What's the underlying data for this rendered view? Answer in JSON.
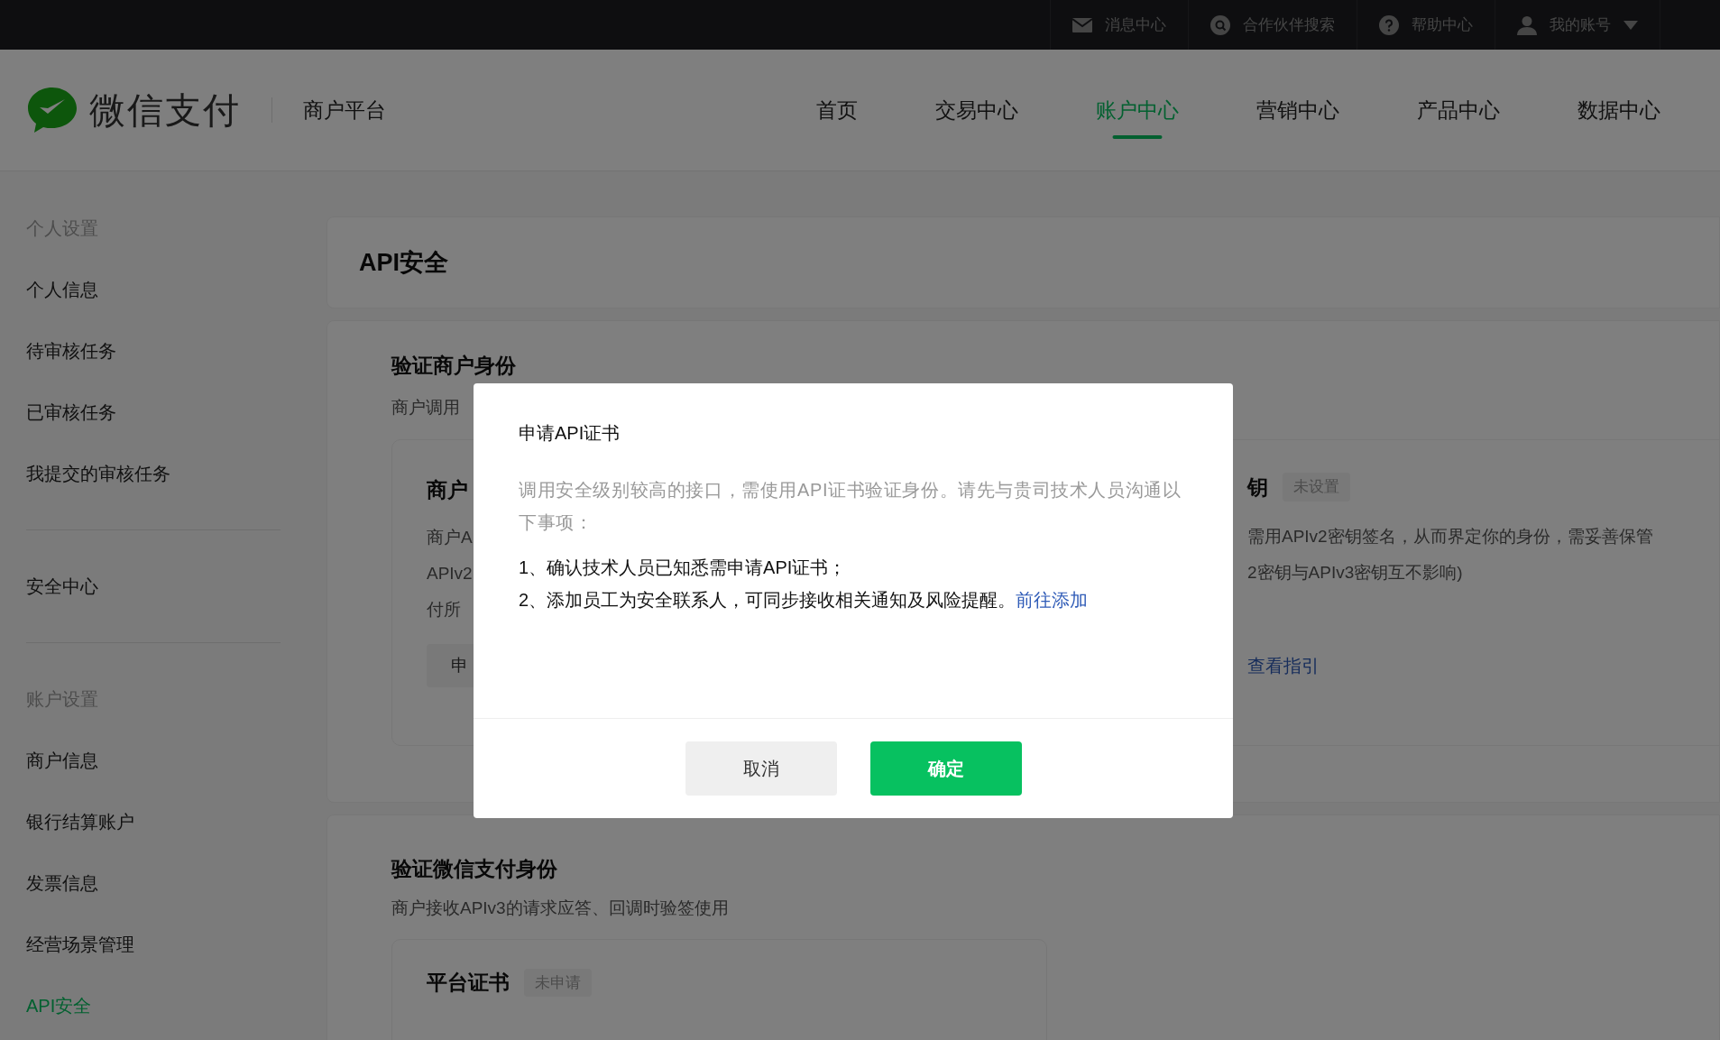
{
  "top_bar": {
    "items": [
      {
        "kind": "messages",
        "label": "消息中心"
      },
      {
        "kind": "search",
        "label": "合作伙伴搜索"
      },
      {
        "kind": "help",
        "label": "帮助中心"
      },
      {
        "kind": "account",
        "label": "我的账号"
      }
    ]
  },
  "header": {
    "logo_text": "微信支付",
    "platform": "商户平台",
    "nav": [
      {
        "label": "首页",
        "selected": false
      },
      {
        "label": "交易中心",
        "selected": false
      },
      {
        "label": "账户中心",
        "selected": true
      },
      {
        "label": "营销中心",
        "selected": false
      },
      {
        "label": "产品中心",
        "selected": false
      },
      {
        "label": "数据中心",
        "selected": false
      }
    ]
  },
  "sidebar": {
    "entries": [
      {
        "kind": "heading",
        "label": "个人设置"
      },
      {
        "kind": "item",
        "label": "个人信息",
        "selected": false
      },
      {
        "kind": "item",
        "label": "待审核任务",
        "selected": false
      },
      {
        "kind": "item",
        "label": "已审核任务",
        "selected": false
      },
      {
        "kind": "item",
        "label": "我提交的审核任务",
        "selected": false
      },
      {
        "kind": "divider"
      },
      {
        "kind": "item",
        "label": "安全中心",
        "selected": false
      },
      {
        "kind": "divider"
      },
      {
        "kind": "heading",
        "label": "账户设置"
      },
      {
        "kind": "item",
        "label": "商户信息",
        "selected": false
      },
      {
        "kind": "item",
        "label": "银行结算账户",
        "selected": false
      },
      {
        "kind": "item",
        "label": "发票信息",
        "selected": false
      },
      {
        "kind": "item",
        "label": "经营场景管理",
        "selected": false
      },
      {
        "kind": "item",
        "label": "API安全",
        "selected": true
      }
    ]
  },
  "page_title": "API安全",
  "merchant_section": {
    "title": "验证商户身份",
    "subtitle": "商户调用",
    "left_card": {
      "title": "商户",
      "lines": [
        "商户A",
        "APIv2",
        "付所"
      ],
      "button": "申"
    },
    "right_card": {
      "title": "钥",
      "badge": "未设置",
      "lines": [
        "需用APIv2密钥签名，从而界定你的身份，需妥善保管",
        "2密钥与APIv3密钥互不影响)"
      ],
      "link": "查看指引"
    }
  },
  "wechat_section": {
    "title": "验证微信支付身份",
    "subtitle": "商户接收APIv3的请求应答、回调时验签使用",
    "card": {
      "title": "平台证书",
      "badge": "未申请"
    }
  },
  "dialog": {
    "title": "申请API证书",
    "intro": "调用安全级别较高的接口，需使用API证书验证身份。请先与贵司技术人员沟通以下事项：",
    "items": [
      {
        "text": "1、确认技术人员已知悉需申请API证书；"
      },
      {
        "text": "2、添加员工为安全联系人，可同步接收相关通知及风险提醒。",
        "link": "前往添加"
      }
    ],
    "cancel": "取消",
    "confirm": "确定"
  }
}
